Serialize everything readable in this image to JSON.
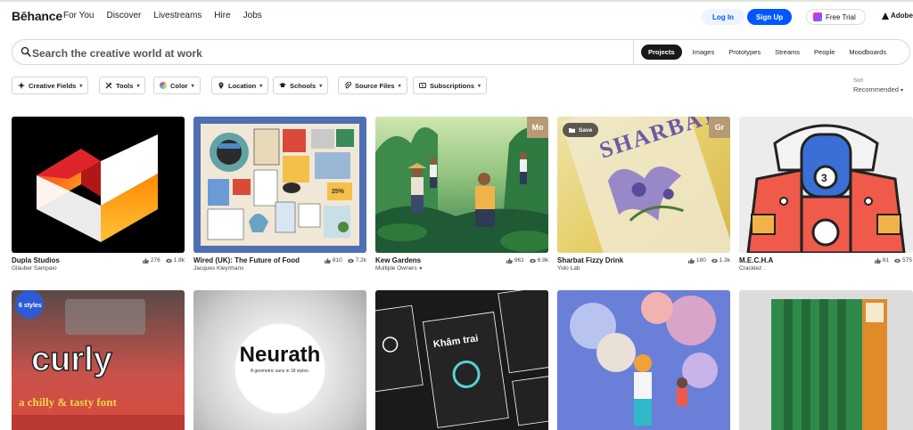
{
  "header": {
    "logo": "Bēhance",
    "nav": [
      "For You",
      "Discover",
      "Livestreams",
      "Hire",
      "Jobs"
    ],
    "login": "Log In",
    "signup": "Sign Up",
    "free_trial": "Free Trial",
    "adobe": "Adobe"
  },
  "search": {
    "placeholder": "Search the creative world at work",
    "tabs": [
      "Projects",
      "Images",
      "Prototypes",
      "Streams",
      "People",
      "Moodboards"
    ],
    "active_tab": "Projects"
  },
  "filters": {
    "creative_fields": "Creative Fields",
    "tools": "Tools",
    "color": "Color",
    "location": "Location",
    "schools": "Schools",
    "source_files": "Source Files",
    "subscriptions": "Subscriptions",
    "sort_label": "Sort",
    "sort_value": "Recommended"
  },
  "projects": [
    {
      "title": "Dupla Studios",
      "owner": "Gláuber Sampaio",
      "likes": "276",
      "views": "1.8k"
    },
    {
      "title": "Wired (UK): The Future of Food",
      "owner": "Jacques Kleynhans",
      "likes": "810",
      "views": "7.2k"
    },
    {
      "title": "Kew Gardens",
      "owner": "Multiple Owners",
      "likes": "961",
      "views": "6.9k",
      "badge": "Mo"
    },
    {
      "title": "Sharbat Fizzy Drink",
      "owner": "Yido Lab",
      "likes": "180",
      "views": "1.3k",
      "badge": "Gr",
      "save": "Save"
    },
    {
      "title": "M.E.C.H.A",
      "owner": "Cracklez .",
      "likes": "81",
      "views": "575"
    }
  ],
  "row2": {
    "curly_text": "curly",
    "curly_sub": "a chilly & tasty font",
    "neurath_title": "Neurath",
    "neurath_sub": "A geometric sans in 18 styles.",
    "kham_title": "Khâm trai"
  },
  "colors": {
    "brand_blue": "#0057ff",
    "login_bg": "#eef3fd",
    "badge": "#b59a73"
  }
}
